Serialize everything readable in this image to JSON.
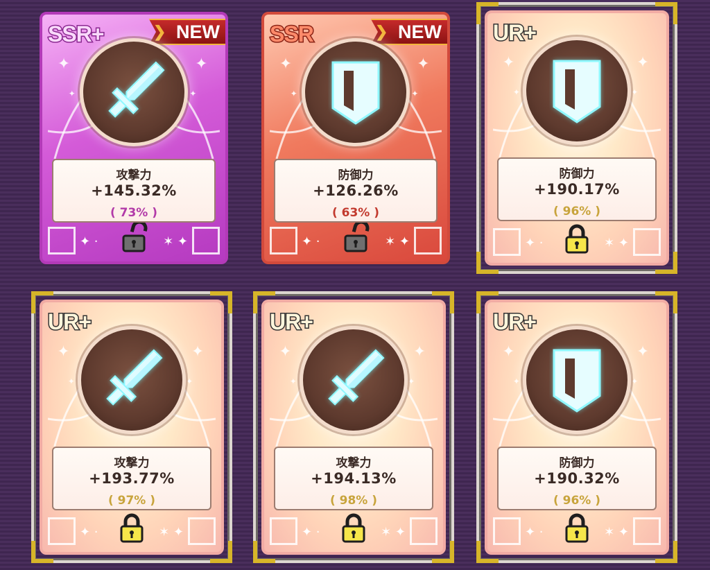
{
  "cards": [
    {
      "rarity": "SSR+",
      "badge": "NEW",
      "weapon": "sword-icon",
      "stat": "攻撃力",
      "value": "+145.32%",
      "percent": "( 73% )",
      "lock": "unlocked",
      "theme": "ssrp"
    },
    {
      "rarity": "SSR",
      "badge": "NEW",
      "weapon": "shield-icon",
      "stat": "防御力",
      "value": "+126.26%",
      "percent": "( 63% )",
      "lock": "unlocked",
      "theme": "ssr"
    },
    {
      "rarity": "UR+",
      "badge": "",
      "weapon": "shield-icon",
      "stat": "防御力",
      "value": "+190.17%",
      "percent": "( 96% )",
      "lock": "locked",
      "theme": "urp"
    },
    {
      "rarity": "UR+",
      "badge": "",
      "weapon": "sword-icon",
      "stat": "攻撃力",
      "value": "+193.77%",
      "percent": "( 97% )",
      "lock": "locked",
      "theme": "urp"
    },
    {
      "rarity": "UR+",
      "badge": "",
      "weapon": "sword-icon",
      "stat": "攻撃力",
      "value": "+194.13%",
      "percent": "( 98% )",
      "lock": "locked",
      "theme": "urp"
    },
    {
      "rarity": "UR+",
      "badge": "",
      "weapon": "shield-icon",
      "stat": "防御力",
      "value": "+190.32%",
      "percent": "( 96% )",
      "lock": "locked",
      "theme": "urp"
    }
  ],
  "colors": {
    "background": "#4a2e5c",
    "ssr_plus": "#d45bd8",
    "ssr": "#f07a5e",
    "ur_plus": "#ffd3b8",
    "gold_frame": "#d7b529",
    "glow": "#7ff6ff"
  }
}
